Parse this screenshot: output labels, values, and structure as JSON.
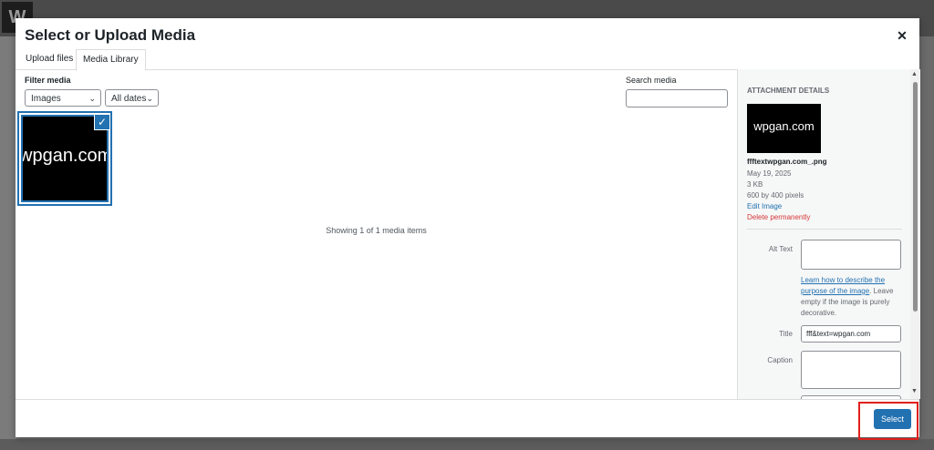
{
  "modal": {
    "title": "Select or Upload Media",
    "close_icon": "close-icon"
  },
  "tabs": [
    {
      "label": "Upload files",
      "active": false
    },
    {
      "label": "Media Library",
      "active": true
    }
  ],
  "filters": {
    "label": "Filter media",
    "type_value": "Images",
    "date_value": "All dates"
  },
  "search": {
    "label": "Search media",
    "value": ""
  },
  "grid": {
    "thumb_text": "wpgan.com",
    "selected": true,
    "status": "Showing 1 of 1 media items"
  },
  "attachment": {
    "heading": "ATTACHMENT DETAILS",
    "thumb_text": "wpgan.com",
    "filename": "ffftextwpgan.com_.png",
    "date": "May 19, 2025",
    "size": "3 KB",
    "dimensions": "600 by 400 pixels",
    "edit_label": "Edit Image",
    "delete_label": "Delete permanently",
    "alt_label": "Alt Text",
    "alt_value": "",
    "help_link": "Learn how to describe the purpose of the image",
    "help_rest": ". Leave empty if the image is purely decorative.",
    "title_label": "Title",
    "title_value": "fff&text=wpgan.com",
    "caption_label": "Caption",
    "caption_value": ""
  },
  "toolbar": {
    "select_label": "Select"
  },
  "colors": {
    "accent": "#2271b1",
    "danger": "#d63638",
    "highlight": "#e0201b"
  }
}
